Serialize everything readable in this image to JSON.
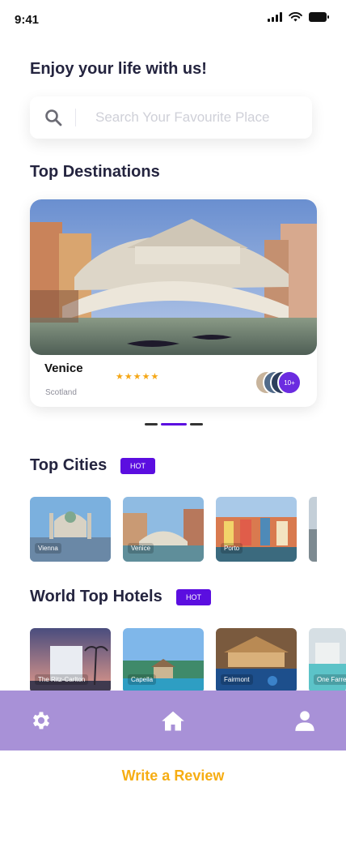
{
  "status": {
    "time": "9:41"
  },
  "greeting": "Enjoy your life with us!",
  "search": {
    "placeholder": "Search Your Favourite Place"
  },
  "top_destinations": {
    "title": "Top Destinations",
    "card": {
      "name": "Venice",
      "country": "Scotland",
      "rating": "★★★★★",
      "more_label": "10+"
    }
  },
  "top_cities": {
    "title": "Top Cities",
    "badge": "HOT",
    "items": [
      {
        "label": "Vienna"
      },
      {
        "label": "Venice"
      },
      {
        "label": "Porto"
      },
      {
        "label": ""
      }
    ]
  },
  "world_top_hotels": {
    "title": "World Top Hotels",
    "badge": "HOT",
    "items": [
      {
        "label": "The Ritz-Carlton"
      },
      {
        "label": "Capella"
      },
      {
        "label": "Fairmont"
      },
      {
        "label": "One Farrer"
      }
    ]
  },
  "bottom_nav": {
    "items": [
      "gear-icon",
      "home-icon",
      "user-icon"
    ]
  },
  "review": {
    "label": "Write a Review"
  },
  "colors": {
    "accent": "#5b0ee0",
    "nav_bg": "#a891d7",
    "review": "#f6ad13",
    "stars": "#f5a716"
  }
}
